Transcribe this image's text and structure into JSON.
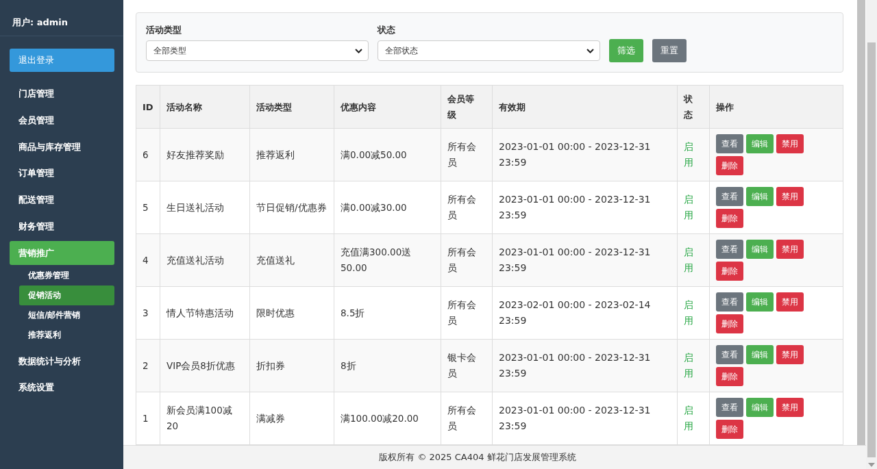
{
  "sidebar": {
    "user": "用户: admin",
    "logout": "退出登录",
    "items": [
      {
        "label": "门店管理",
        "selected": false
      },
      {
        "label": "会员管理",
        "selected": false
      },
      {
        "label": "商品与库存管理",
        "selected": false
      },
      {
        "label": "订单管理",
        "selected": false
      },
      {
        "label": "配送管理",
        "selected": false
      },
      {
        "label": "财务管理",
        "selected": false
      },
      {
        "label": "营销推广",
        "selected": true,
        "children": [
          {
            "label": "优惠券管理",
            "selected": false
          },
          {
            "label": "促销活动",
            "selected": true
          },
          {
            "label": "短信/邮件营销",
            "selected": false
          },
          {
            "label": "推荐返利",
            "selected": false
          }
        ]
      },
      {
        "label": "数据统计与分析",
        "selected": false
      },
      {
        "label": "系统设置",
        "selected": false
      }
    ]
  },
  "filters": {
    "fields": [
      {
        "label": "活动类型",
        "value": "全部类型"
      },
      {
        "label": "状态",
        "value": "全部状态"
      }
    ],
    "buttons": [
      {
        "label": "筛选",
        "kind": "success"
      },
      {
        "label": "重置",
        "kind": "secondary"
      }
    ]
  },
  "table": {
    "columns": [
      "ID",
      "活动名称",
      "活动类型",
      "优惠内容",
      "会员等级",
      "有效期",
      "状态",
      "操作"
    ],
    "rows": [
      {
        "cells": [
          "6",
          "好友推荐奖励",
          "推荐返利",
          "满0.00减50.00",
          "所有会员",
          "2023-01-01 00:00 - 2023-12-31 23:59"
        ],
        "status": {
          "text": "启用",
          "enabled": true
        },
        "actions": [
          {
            "label": "查看",
            "kind": "secondary"
          },
          {
            "label": "编辑",
            "kind": "success"
          },
          {
            "label": "禁用",
            "kind": "danger"
          },
          {
            "label": "删除",
            "kind": "danger"
          }
        ]
      },
      {
        "cells": [
          "5",
          "生日送礼活动",
          "节日促销/优惠券",
          "满0.00减30.00",
          "所有会员",
          "2023-01-01 00:00 - 2023-12-31 23:59"
        ],
        "status": {
          "text": "启用",
          "enabled": true
        },
        "actions": [
          {
            "label": "查看",
            "kind": "secondary"
          },
          {
            "label": "编辑",
            "kind": "success"
          },
          {
            "label": "禁用",
            "kind": "danger"
          },
          {
            "label": "删除",
            "kind": "danger"
          }
        ]
      },
      {
        "cells": [
          "4",
          "充值送礼活动",
          "充值送礼",
          "充值满300.00送50.00",
          "所有会员",
          "2023-01-01 00:00 - 2023-12-31 23:59"
        ],
        "status": {
          "text": "启用",
          "enabled": true
        },
        "actions": [
          {
            "label": "查看",
            "kind": "secondary"
          },
          {
            "label": "编辑",
            "kind": "success"
          },
          {
            "label": "禁用",
            "kind": "danger"
          },
          {
            "label": "删除",
            "kind": "danger"
          }
        ]
      },
      {
        "cells": [
          "3",
          "情人节特惠活动",
          "限时优惠",
          "8.5折",
          "所有会员",
          "2023-02-01 00:00 - 2023-02-14 23:59"
        ],
        "status": {
          "text": "启用",
          "enabled": true
        },
        "actions": [
          {
            "label": "查看",
            "kind": "secondary"
          },
          {
            "label": "编辑",
            "kind": "success"
          },
          {
            "label": "禁用",
            "kind": "danger"
          },
          {
            "label": "删除",
            "kind": "danger"
          }
        ]
      },
      {
        "cells": [
          "2",
          "VIP会员8折优惠",
          "折扣券",
          "8折",
          "银卡会员",
          "2023-01-01 00:00 - 2023-12-31 23:59"
        ],
        "status": {
          "text": "启用",
          "enabled": true
        },
        "actions": [
          {
            "label": "查看",
            "kind": "secondary"
          },
          {
            "label": "编辑",
            "kind": "success"
          },
          {
            "label": "禁用",
            "kind": "danger"
          },
          {
            "label": "删除",
            "kind": "danger"
          }
        ]
      },
      {
        "cells": [
          "1",
          "新会员满100减20",
          "满减券",
          "满100.00减20.00",
          "所有会员",
          "2023-01-01 00:00 - 2023-12-31 23:59"
        ],
        "status": {
          "text": "启用",
          "enabled": true
        },
        "actions": [
          {
            "label": "查看",
            "kind": "secondary"
          },
          {
            "label": "编辑",
            "kind": "success"
          },
          {
            "label": "禁用",
            "kind": "danger"
          },
          {
            "label": "删除",
            "kind": "danger"
          }
        ]
      }
    ]
  },
  "footer": "版权所有 © 2025 CA404 鲜花门店发展管理系统"
}
